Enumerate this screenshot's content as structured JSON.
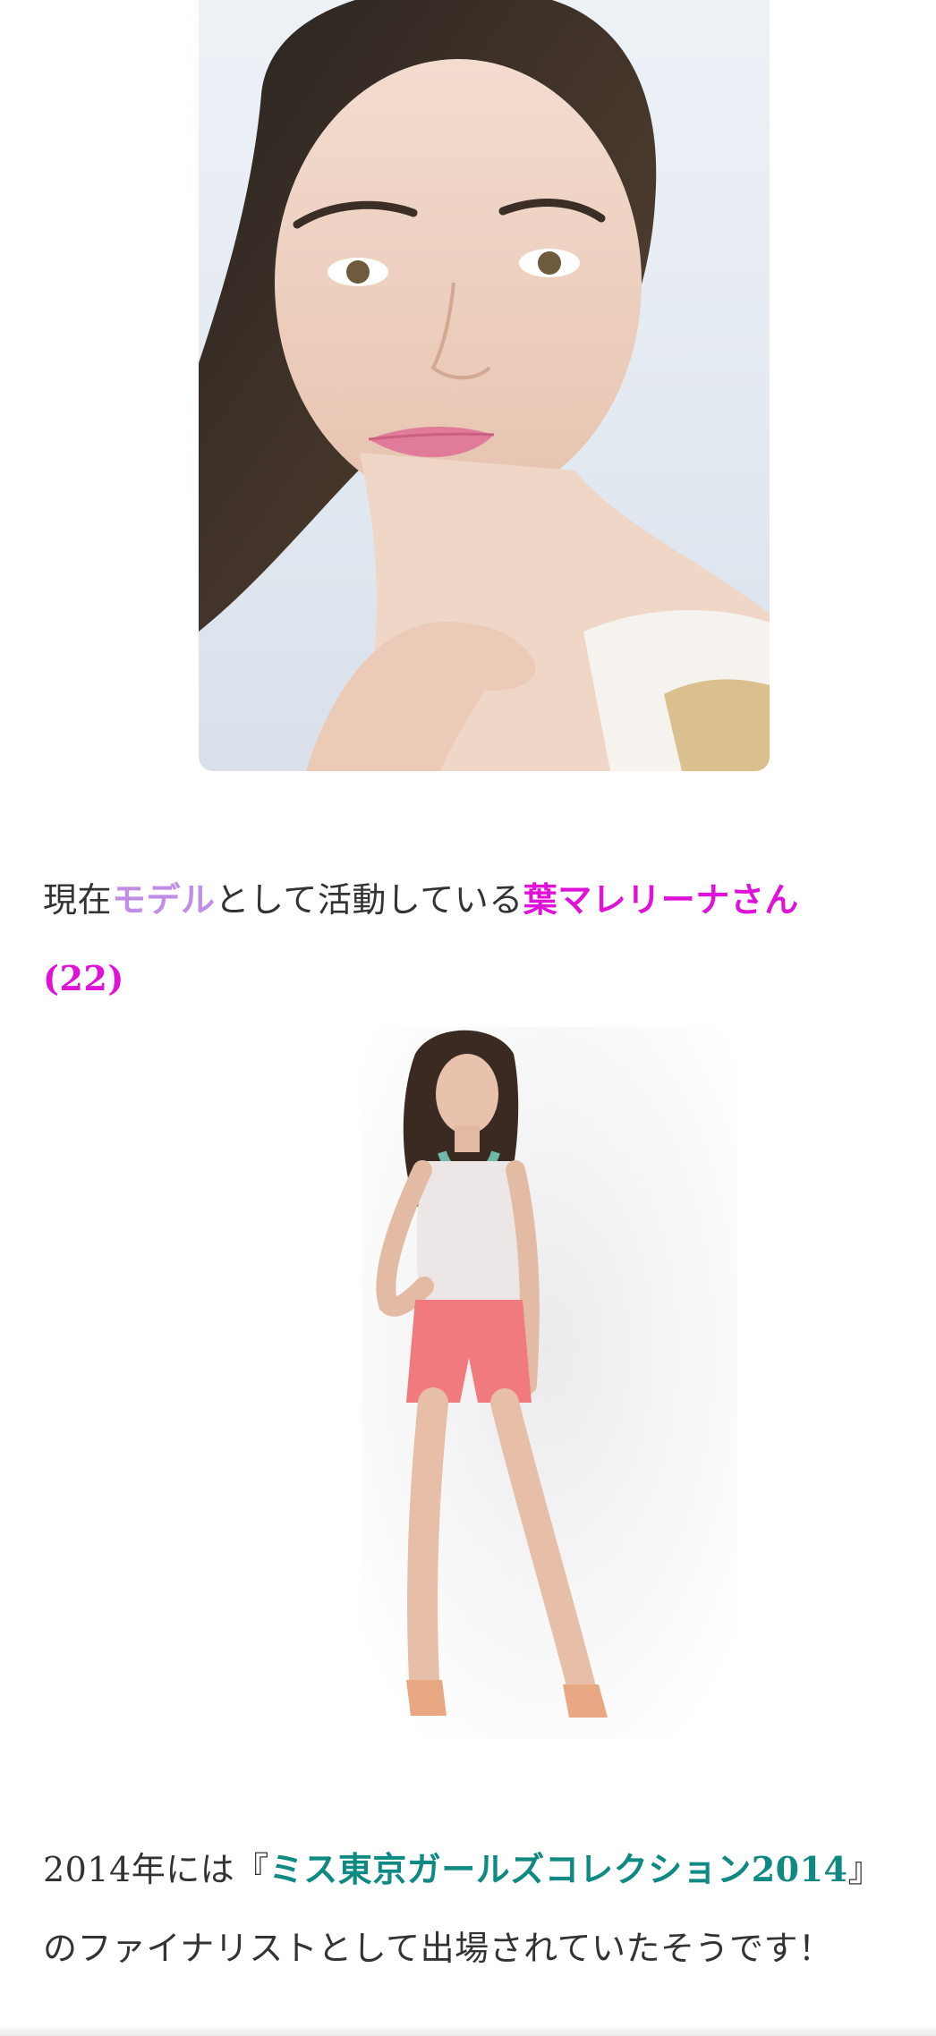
{
  "images": {
    "portrait": {
      "subject": "portrait-photo"
    },
    "fullbody": {
      "subject": "fullbody-photo"
    }
  },
  "paragraph1": {
    "part1": "現在",
    "part2": "モデル",
    "part3": "として活動している",
    "part4": "葉マレリーナさん",
    "part5": "(22)"
  },
  "paragraph2": {
    "part1": "2014年には『",
    "part2": "ミス東京ガールズコレクション2014",
    "part3": "』",
    "part4": "のファイナリストとして出場されていたそうです！"
  },
  "colors": {
    "text": "#333333",
    "lavender": "#c08ee6",
    "magenta": "#e011d8",
    "teal": "#0f8a83"
  }
}
